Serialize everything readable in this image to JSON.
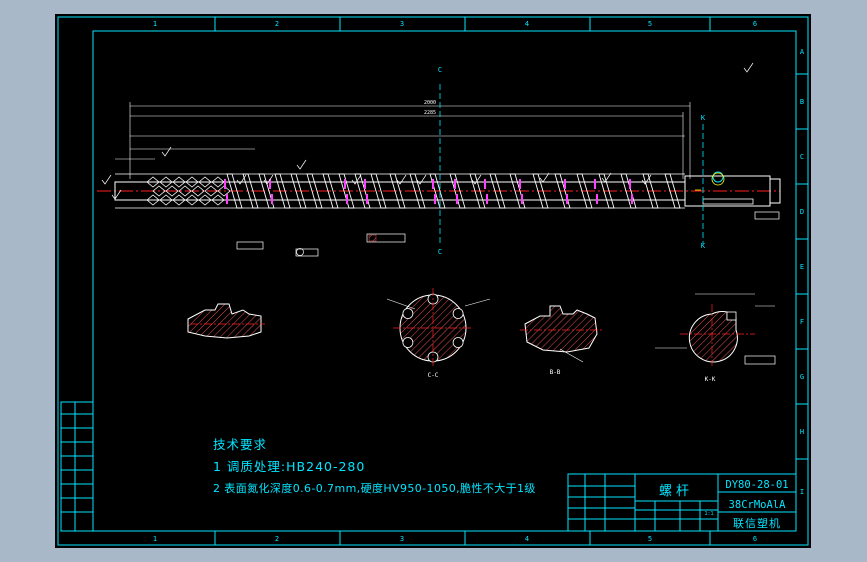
{
  "drawing": {
    "section_labels": {
      "c_top": "C",
      "c_bottom": "C",
      "k_top": "K",
      "k_bottom": "K",
      "section_cc": "C-C",
      "section_bb": "B-B",
      "section_kk": "K-K"
    },
    "dimensions": {
      "overall_top": "2000",
      "overall_second": "2285"
    },
    "frame_zone_numbers_top": [
      "1",
      "2",
      "3",
      "4",
      "5",
      "6"
    ],
    "frame_zone_numbers_bottom": [
      "1",
      "2",
      "3",
      "4",
      "5",
      "6"
    ],
    "frame_zone_letters_right": [
      "A",
      "B",
      "C",
      "D",
      "E",
      "F",
      "G",
      "H",
      "I"
    ]
  },
  "tech_requirements": {
    "heading": "技术要求",
    "item1": "1 调质处理:HB240-280",
    "item2": "2 表面氮化深度0.6-0.7mm,硬度HV950-1050,脆性不大于1级"
  },
  "title_block": {
    "part_name": "螺杆",
    "drawing_no": "DY80-28-01",
    "material": "38CrMoAlA",
    "company": "联信塑机",
    "scale_value": "1:1"
  },
  "colors": {
    "background": "#000000",
    "frame": "#00e5ff",
    "centerline": "#ff2020",
    "hatch": "#e05050",
    "highlight": "#ff40ff",
    "annotation": "#ffff00"
  }
}
